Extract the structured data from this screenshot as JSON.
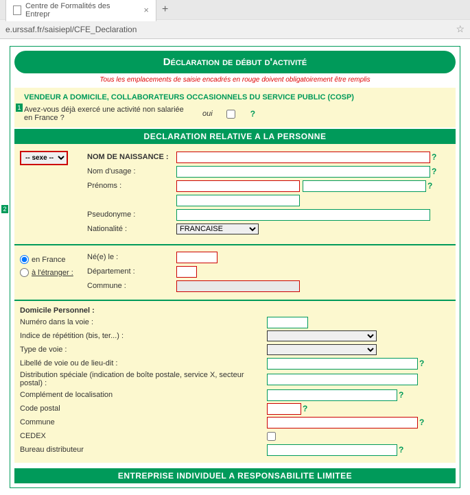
{
  "browser": {
    "tab_title": "Centre de Formalités des Entrepr",
    "url": "e.urssaf.fr/saisiepl/CFE_Declaration"
  },
  "title_bar": "Déclaration de début d'activité",
  "instruction": "Tous les emplacements de saisie encadrés en rouge doivent obligatoirement être remplis",
  "s1": {
    "num": "1",
    "heading": "VENDEUR A DOMICILE, COLLABORATEURS OCCASIONNELS DU SERVICE PUBLIC (COSP)",
    "q": "Avez-vous déjà exercé une activité non salariée en France ?",
    "oui": "oui"
  },
  "header_person": "DECLARATION RELATIVE A LA PERSONNE",
  "person": {
    "num": "2",
    "sexe_placeholder": "-- sexe --",
    "nom_naissance": "NOM DE NAISSANCE :",
    "nom_usage": "Nom d'usage :",
    "prenoms": "Prénoms :",
    "pseudo": "Pseudonyme :",
    "nationalite": "Nationalité :",
    "nationalite_val": "FRANCAISE"
  },
  "birth": {
    "nee": "Né(e) le :",
    "dept": "Département :",
    "commune": "Commune :",
    "en_france": "en France",
    "etranger": "à l'étranger :"
  },
  "addr": {
    "heading": "Domicile Personnel :",
    "numero": "Numéro dans la voie :",
    "indice": "Indice de répétition (bis, ter...) :",
    "typevoie": "Type de voie :",
    "libelle": "Libellé de voie ou de lieu-dit :",
    "distrib": "Distribution spéciale (indication de boîte postale, service X, secteur postal) :",
    "complement": "Complément de localisation",
    "cp": "Code postal",
    "commune": "Commune",
    "cedex": "CEDEX",
    "bureau": "Bureau distributeur"
  },
  "header_ei": "ENTREPRISE INDIVIDUEL A RESPONSABILITE LIMITEE",
  "qmark": "?"
}
